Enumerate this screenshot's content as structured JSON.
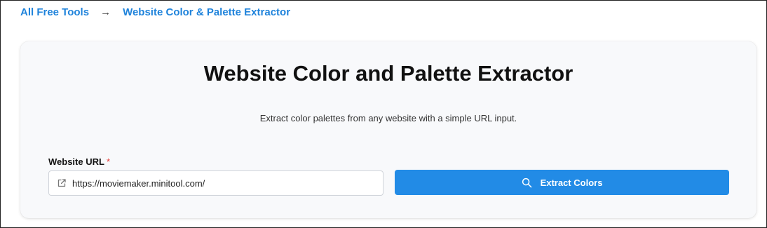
{
  "breadcrumb": {
    "home_label": "All Free Tools",
    "separator": "→",
    "current_label": "Website Color & Palette Extractor"
  },
  "page": {
    "title": "Website Color and Palette Extractor",
    "subtitle": "Extract color palettes from any website with a simple URL input."
  },
  "form": {
    "url_label": "Website URL",
    "required_marker": "*",
    "url_value": "https://moviemaker.minitool.com/",
    "url_icon": "external-link-icon",
    "submit_label": "Extract Colors",
    "submit_icon": "search-icon"
  },
  "colors": {
    "accent": "#228be6",
    "link": "#1f83db",
    "required": "#e53935",
    "card_bg": "#f8f9fb"
  }
}
